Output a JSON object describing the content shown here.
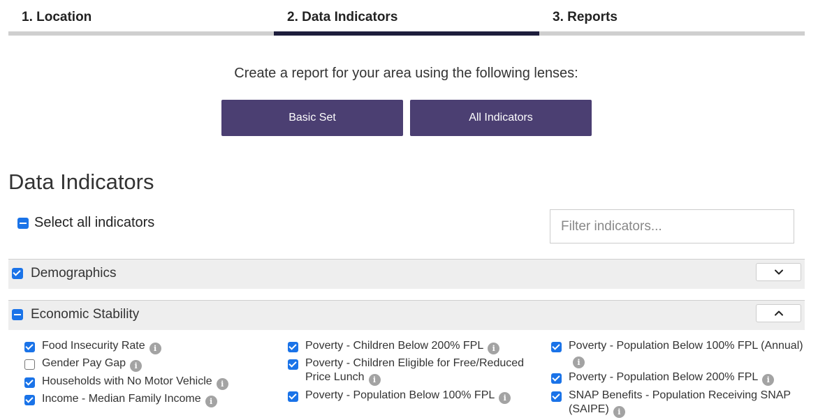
{
  "steps": [
    {
      "label": "1. Location",
      "active": false
    },
    {
      "label": "2. Data Indicators",
      "active": true
    },
    {
      "label": "3. Reports",
      "active": false
    }
  ],
  "lens": {
    "intro": "Create a report for your area using the following lenses:",
    "basic_label": "Basic Set",
    "all_label": "All Indicators"
  },
  "page_title": "Data Indicators",
  "select_all": {
    "label": "Select all indicators",
    "state": "mixed"
  },
  "filter": {
    "placeholder": "Filter indicators...",
    "value": ""
  },
  "categories": [
    {
      "label": "Demographics",
      "state": "checked",
      "expanded": false,
      "toggle_icon": "chevron-down-icon"
    },
    {
      "label": "Economic Stability",
      "state": "mixed",
      "expanded": true,
      "toggle_icon": "chevron-up-icon"
    }
  ],
  "indicators": {
    "col1": [
      {
        "label": "Food Insecurity Rate",
        "checked": true
      },
      {
        "label": "Gender Pay Gap",
        "checked": false
      },
      {
        "label": "Households with No Motor Vehicle",
        "checked": true
      },
      {
        "label": "Income - Median Family Income",
        "checked": true
      }
    ],
    "col2": [
      {
        "label": "Poverty - Children Below 200% FPL",
        "checked": true
      },
      {
        "label": "Poverty - Children Eligible for Free/Reduced Price Lunch",
        "checked": true
      },
      {
        "label": "Poverty - Population Below 100% FPL",
        "checked": true
      }
    ],
    "col3": [
      {
        "label": "Poverty - Population Below 100% FPL (Annual)",
        "checked": true
      },
      {
        "label": "Poverty - Population Below 200% FPL",
        "checked": true
      },
      {
        "label": "SNAP Benefits - Population Receiving SNAP (SAIPE)",
        "checked": true
      }
    ]
  },
  "info_icon": {
    "name": "info-icon",
    "glyph": "i"
  },
  "colors": {
    "accent": "#4b3f72",
    "active_tab": "#1e1e3c",
    "checkbox": "#1a73e8",
    "category_bg": "#eeeeee",
    "info_icon": "#a3a3a3"
  }
}
